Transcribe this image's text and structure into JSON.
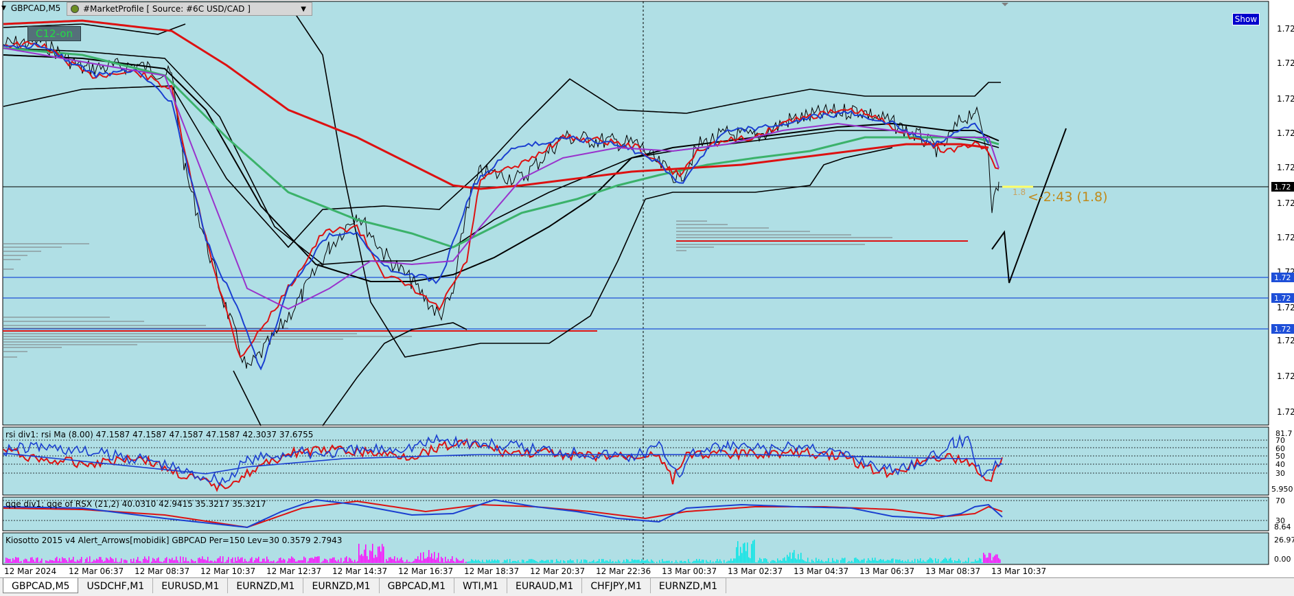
{
  "chart": {
    "symbol_label": "GBPCAD,M5",
    "market_profile_dropdown": "#MarketProfile [ Source: #6C USD/CAD ]",
    "c12_label": "C12-on",
    "show_label": "Show",
    "annotation": "<-2:43 (1.8)",
    "small_annotation": "1.8",
    "bg_color": "#b0dfe5",
    "price_axis_labels": [
      "1.72",
      "1.72",
      "1.72",
      "1.72",
      "1.72",
      "1.72",
      "1.72",
      "1.72",
      "1.72",
      "1.72",
      "1.72",
      "1.72",
      "1.72"
    ],
    "price_tag_current": "1.72",
    "price_tag_lines": [
      "1.72",
      "1.72",
      "1.72"
    ]
  },
  "rsi_panel": {
    "title": "rsi div1: rsi Ma (8.00) 47.1587 47.1587 47.1587 47.1587 42.3037 37.6755",
    "levels": [
      "81.7",
      "70",
      "60",
      "50",
      "40",
      "30",
      "5.950"
    ]
  },
  "qqe_panel": {
    "title": "qqe div1: qqe of RSX (21,2) 40.0310 42.9415 35.3217 35.3217",
    "levels": [
      "70",
      "30",
      "8.64"
    ]
  },
  "kiosotto_panel": {
    "title": "Kiosotto 2015 v4 Alert_Arrows[mobidik] GBPCAD Per=150 Lev=30 0.3579 2.7943",
    "levels": [
      "26.97",
      "0.00"
    ]
  },
  "time_axis": [
    "12 Mar 2024",
    "12 Mar 06:37",
    "12 Mar 08:37",
    "12 Mar 10:37",
    "12 Mar 12:37",
    "12 Mar 14:37",
    "12 Mar 16:37",
    "12 Mar 18:37",
    "12 Mar 20:37",
    "12 Mar 22:36",
    "13 Mar 00:37",
    "13 Mar 02:37",
    "13 Mar 04:37",
    "13 Mar 06:37",
    "13 Mar 08:37",
    "13 Mar 10:37"
  ],
  "tabs": [
    "GBPCAD,M5",
    "USDCHF,M1",
    "EURUSD,M1",
    "EURNZD,M1",
    "EURNZD,M1",
    "GBPCAD,M1",
    "WTI,M1",
    "EURAUD,M1",
    "CHFJPY,M1",
    "EURNZD,M1"
  ]
}
